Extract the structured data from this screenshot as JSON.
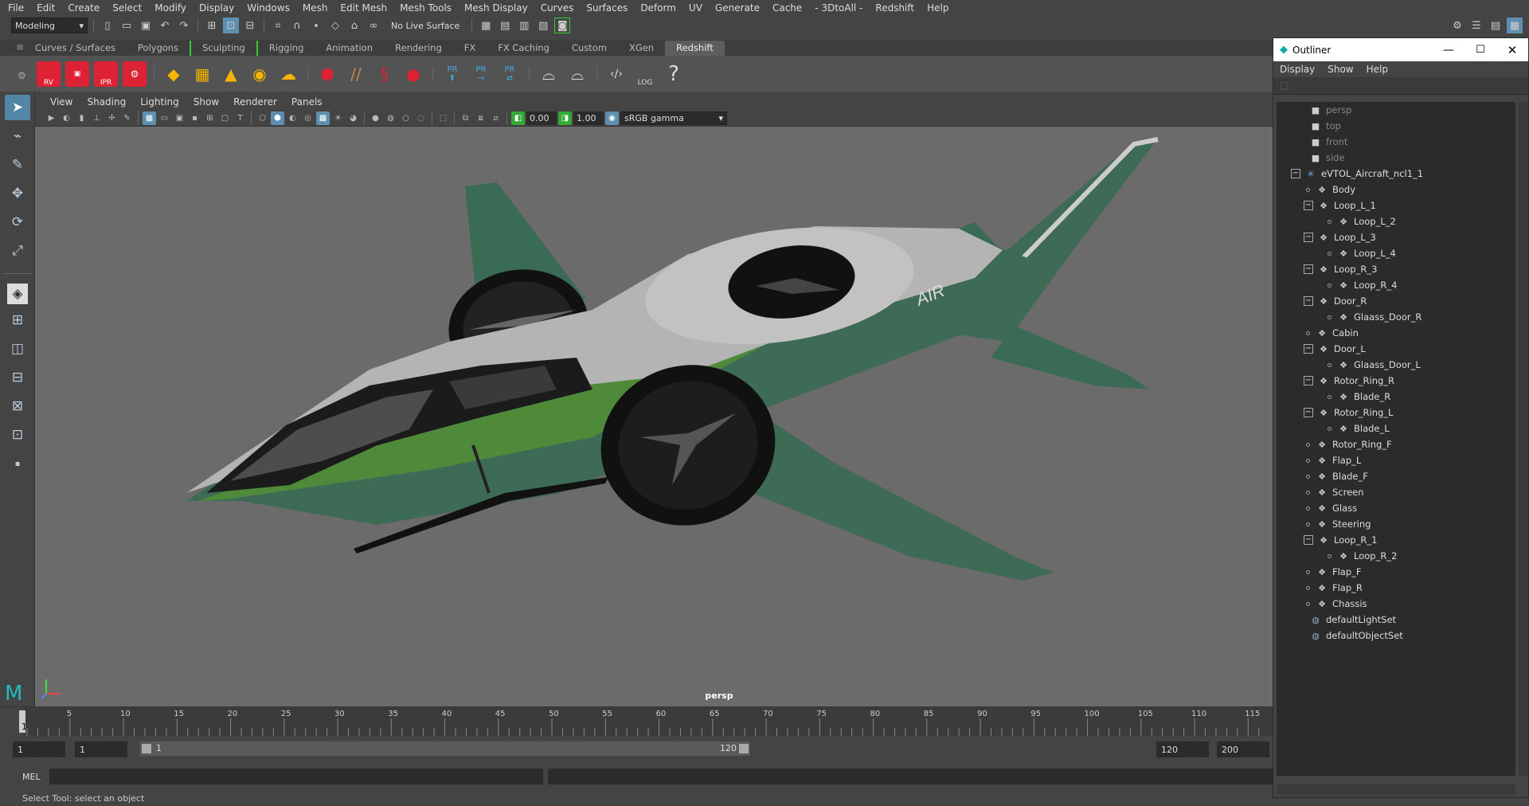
{
  "menu": [
    "File",
    "Edit",
    "Create",
    "Select",
    "Modify",
    "Display",
    "Windows",
    "Mesh",
    "Edit Mesh",
    "Mesh Tools",
    "Mesh Display",
    "Curves",
    "Surfaces",
    "Deform",
    "UV",
    "Generate",
    "Cache",
    "- 3DtoAll -",
    "Redshift",
    "Help"
  ],
  "status": {
    "mode": "Modeling",
    "live_surface": "No Live Surface"
  },
  "shelf_tabs": [
    "Curves / Surfaces",
    "Polygons",
    "Sculpting",
    "Rigging",
    "Animation",
    "Rendering",
    "FX",
    "FX Caching",
    "Custom",
    "XGen",
    "Redshift"
  ],
  "shelf_active": "Redshift",
  "shelf_labels": [
    "RV",
    "",
    "IPR",
    "",
    "PR",
    "PR",
    "PR",
    "LOG",
    "?"
  ],
  "viewport_menu": [
    "View",
    "Shading",
    "Lighting",
    "Show",
    "Renderer",
    "Panels"
  ],
  "viewport_fields": {
    "exposure": "0.00",
    "gamma": "1.00",
    "color_space": "sRGB gamma"
  },
  "viewport": {
    "camera": "persp",
    "logo_text": "AIR"
  },
  "timeline": {
    "ticks": [
      "5",
      "10",
      "15",
      "20",
      "25",
      "30",
      "35",
      "40",
      "45",
      "50",
      "55",
      "60",
      "65",
      "70",
      "75",
      "80",
      "85",
      "90",
      "95",
      "100",
      "105",
      "110",
      "115"
    ],
    "current_frame": "1"
  },
  "range": {
    "start": "1",
    "anim_start": "1",
    "slider_start": "1",
    "slider_end": "120",
    "end": "120",
    "anim_end": "200"
  },
  "command": {
    "label": "MEL"
  },
  "help_line": "Select Tool: select an object",
  "outliner": {
    "title": "Outliner",
    "menu": [
      "Display",
      "Show",
      "Help"
    ],
    "cameras": [
      "persp",
      "top",
      "front",
      "side"
    ],
    "root": "eVTOL_Aircraft_ncl1_1",
    "items": [
      {
        "name": "Body",
        "level": 1,
        "expand": false
      },
      {
        "name": "Loop_L_1",
        "level": 1,
        "expand": true
      },
      {
        "name": "Loop_L_2",
        "level": 2,
        "expand": false
      },
      {
        "name": "Loop_L_3",
        "level": 1,
        "expand": true
      },
      {
        "name": "Loop_L_4",
        "level": 2,
        "expand": false
      },
      {
        "name": "Loop_R_3",
        "level": 1,
        "expand": true
      },
      {
        "name": "Loop_R_4",
        "level": 2,
        "expand": false
      },
      {
        "name": "Door_R",
        "level": 1,
        "expand": true
      },
      {
        "name": "Glaass_Door_R",
        "level": 2,
        "expand": false
      },
      {
        "name": "Cabin",
        "level": 1,
        "expand": false
      },
      {
        "name": "Door_L",
        "level": 1,
        "expand": true
      },
      {
        "name": "Glaass_Door_L",
        "level": 2,
        "expand": false
      },
      {
        "name": "Rotor_Ring_R",
        "level": 1,
        "expand": true
      },
      {
        "name": "Blade_R",
        "level": 2,
        "expand": false
      },
      {
        "name": "Rotor_Ring_L",
        "level": 1,
        "expand": true
      },
      {
        "name": "Blade_L",
        "level": 2,
        "expand": false
      },
      {
        "name": "Rotor_Ring_F",
        "level": 1,
        "expand": false
      },
      {
        "name": "Flap_L",
        "level": 1,
        "expand": false
      },
      {
        "name": "Blade_F",
        "level": 1,
        "expand": false
      },
      {
        "name": "Screen",
        "level": 1,
        "expand": false
      },
      {
        "name": "Glass",
        "level": 1,
        "expand": false
      },
      {
        "name": "Steering",
        "level": 1,
        "expand": false
      },
      {
        "name": "Loop_R_1",
        "level": 1,
        "expand": true
      },
      {
        "name": "Loop_R_2",
        "level": 2,
        "expand": false
      },
      {
        "name": "Flap_F",
        "level": 1,
        "expand": false
      },
      {
        "name": "Flap_R",
        "level": 1,
        "expand": false
      },
      {
        "name": "Chassis",
        "level": 1,
        "expand": false
      }
    ],
    "sets": [
      "defaultLightSet",
      "defaultObjectSet"
    ]
  },
  "colors": {
    "accent": "#5285a6",
    "aircraft_green": "#3d6b55",
    "aircraft_grey": "#b4b4b4",
    "viewport_bg": "#6b6b6b"
  }
}
